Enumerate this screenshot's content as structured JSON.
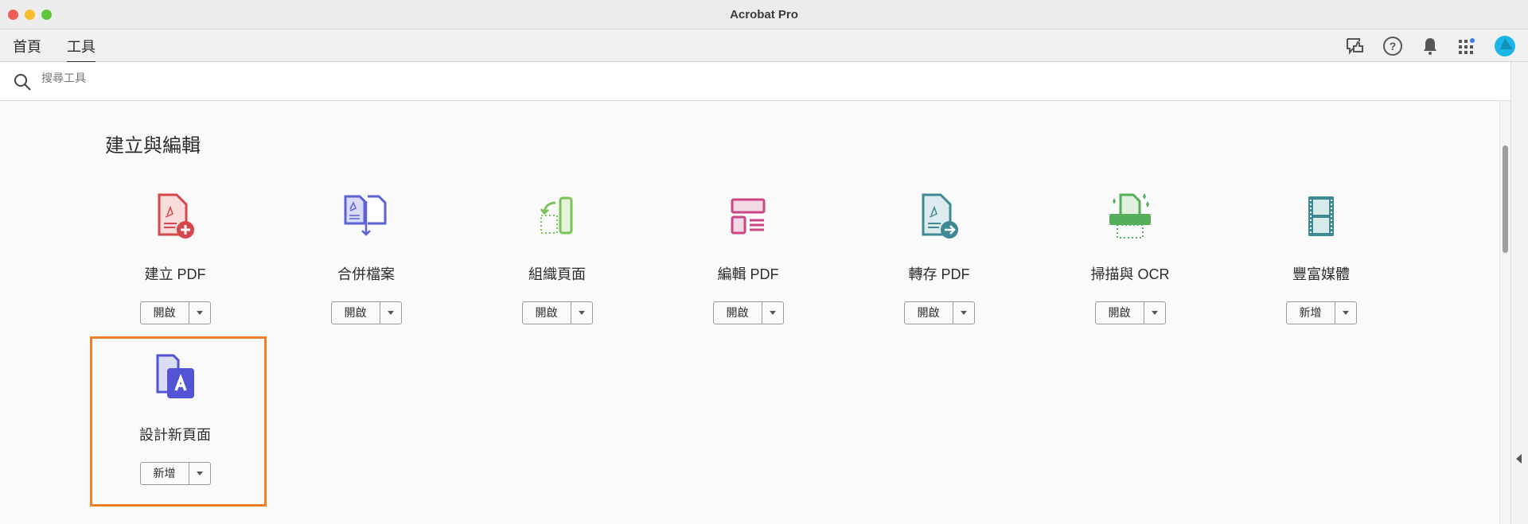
{
  "window": {
    "title": "Acrobat Pro"
  },
  "tabs": [
    {
      "label": "首頁"
    },
    {
      "label": "工具"
    }
  ],
  "search": {
    "placeholder": "搜尋工具",
    "value": ""
  },
  "section": {
    "title": "建立與編輯"
  },
  "tools": [
    {
      "label": "建立 PDF",
      "button": "開啟",
      "icon": "create-pdf",
      "color": "#d5474b"
    },
    {
      "label": "合併檔案",
      "button": "開啟",
      "icon": "combine-files",
      "color": "#5c62d6"
    },
    {
      "label": "組織頁面",
      "button": "開啟",
      "icon": "organize-pages",
      "color": "#7cc25b"
    },
    {
      "label": "編輯 PDF",
      "button": "開啟",
      "icon": "edit-pdf",
      "color": "#c94586"
    },
    {
      "label": "轉存 PDF",
      "button": "開啟",
      "icon": "export-pdf",
      "color": "#3d8a94"
    },
    {
      "label": "掃描與 OCR",
      "button": "開啟",
      "icon": "scan-ocr",
      "color": "#56ad5a"
    },
    {
      "label": "豐富媒體",
      "button": "新增",
      "icon": "rich-media",
      "color": "#3e8a93"
    },
    {
      "label": "設計新頁面",
      "button": "新增",
      "icon": "design-page",
      "color": "#5254d4"
    }
  ]
}
